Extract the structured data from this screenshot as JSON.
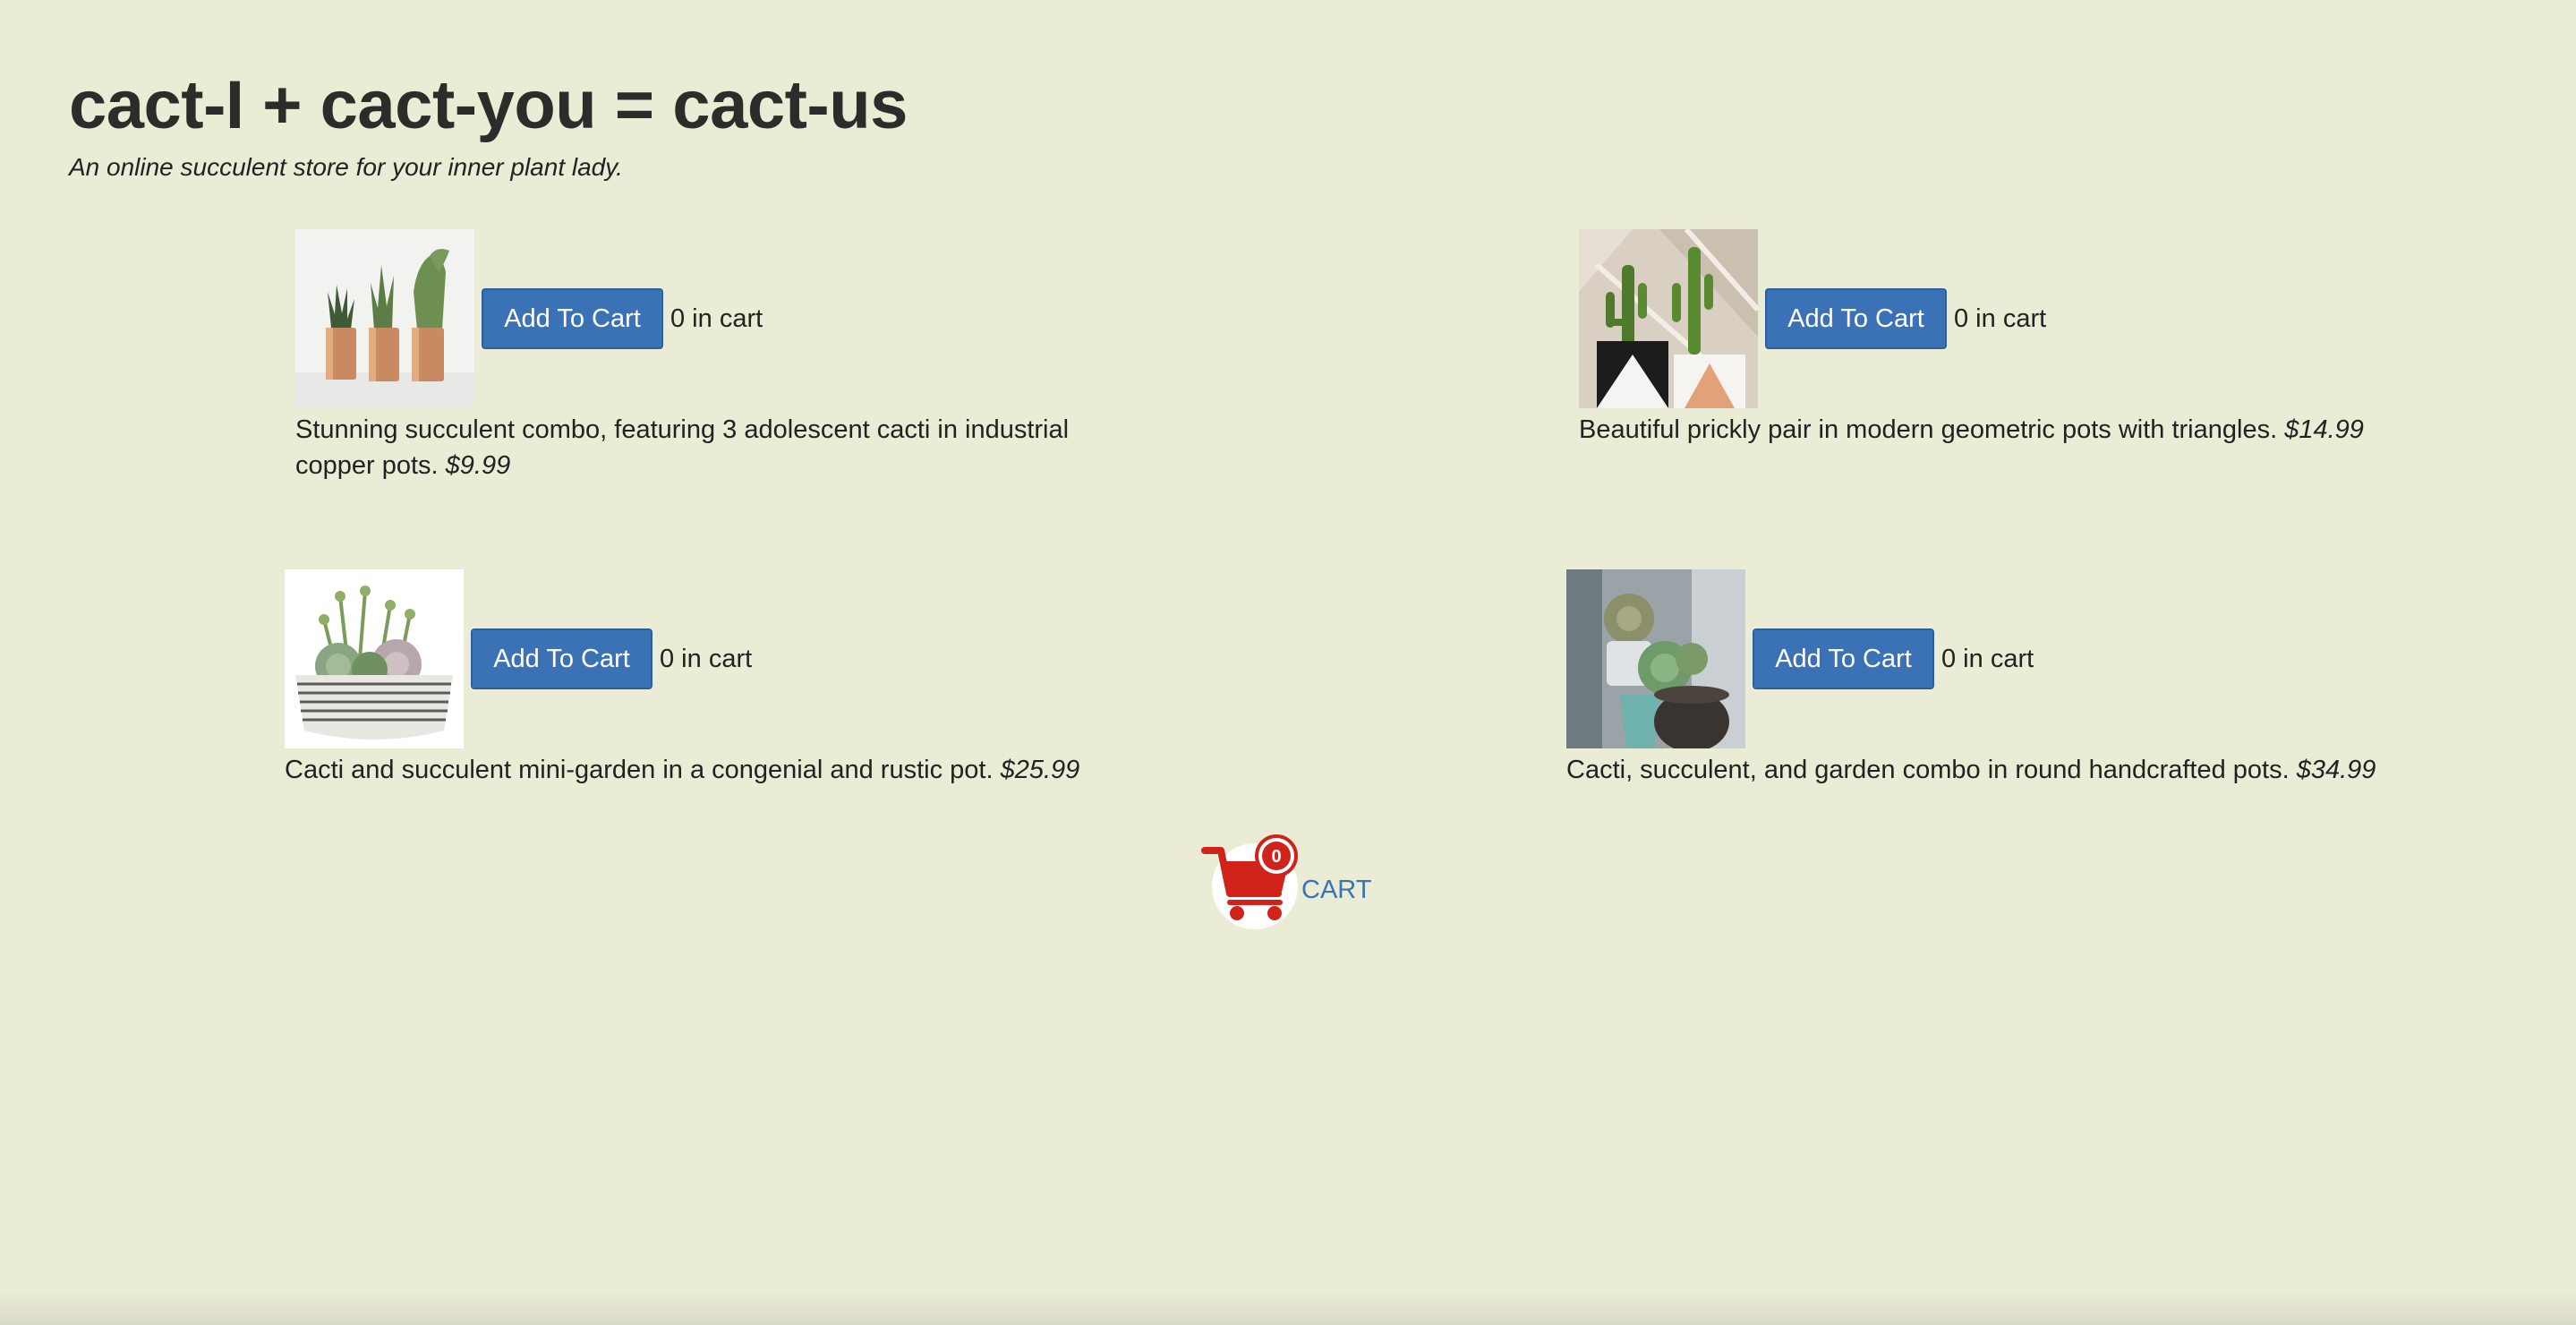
{
  "header": {
    "title": "cact-I + cact-you = cact-us",
    "subtitle": "An online succulent store for your inner plant lady."
  },
  "products": [
    {
      "image": "three cacti in copper pots",
      "button_label": "Add To Cart",
      "count_text": "0 in cart",
      "description": "Stunning succulent combo, featuring 3 adolescent cacti in industrial copper pots.",
      "price": "$9.99"
    },
    {
      "image": "two cacti in black and white geometric pots",
      "button_label": "Add To Cart",
      "count_text": "0 in cart",
      "description": "Beautiful prickly pair in modern geometric pots with triangles.",
      "price": "$14.99"
    },
    {
      "image": "succulent mini-garden in striped rustic bowl",
      "button_label": "Add To Cart",
      "count_text": "0 in cart",
      "description": "Cacti and succulent mini-garden in a congenial and rustic pot.",
      "price": "$25.99"
    },
    {
      "image": "succulents in round handcrafted pots",
      "button_label": "Add To Cart",
      "count_text": "0 in cart",
      "description": "Cacti, succulent, and garden combo in round handcrafted pots.",
      "price": "$34.99"
    }
  ],
  "cart": {
    "count": "0",
    "label": "CART",
    "icon": "shopping-cart-icon"
  },
  "colors": {
    "background": "#ebecd6",
    "button": "#3b72b6",
    "cart_icon": "#d0241b",
    "link": "#3b72b6"
  }
}
